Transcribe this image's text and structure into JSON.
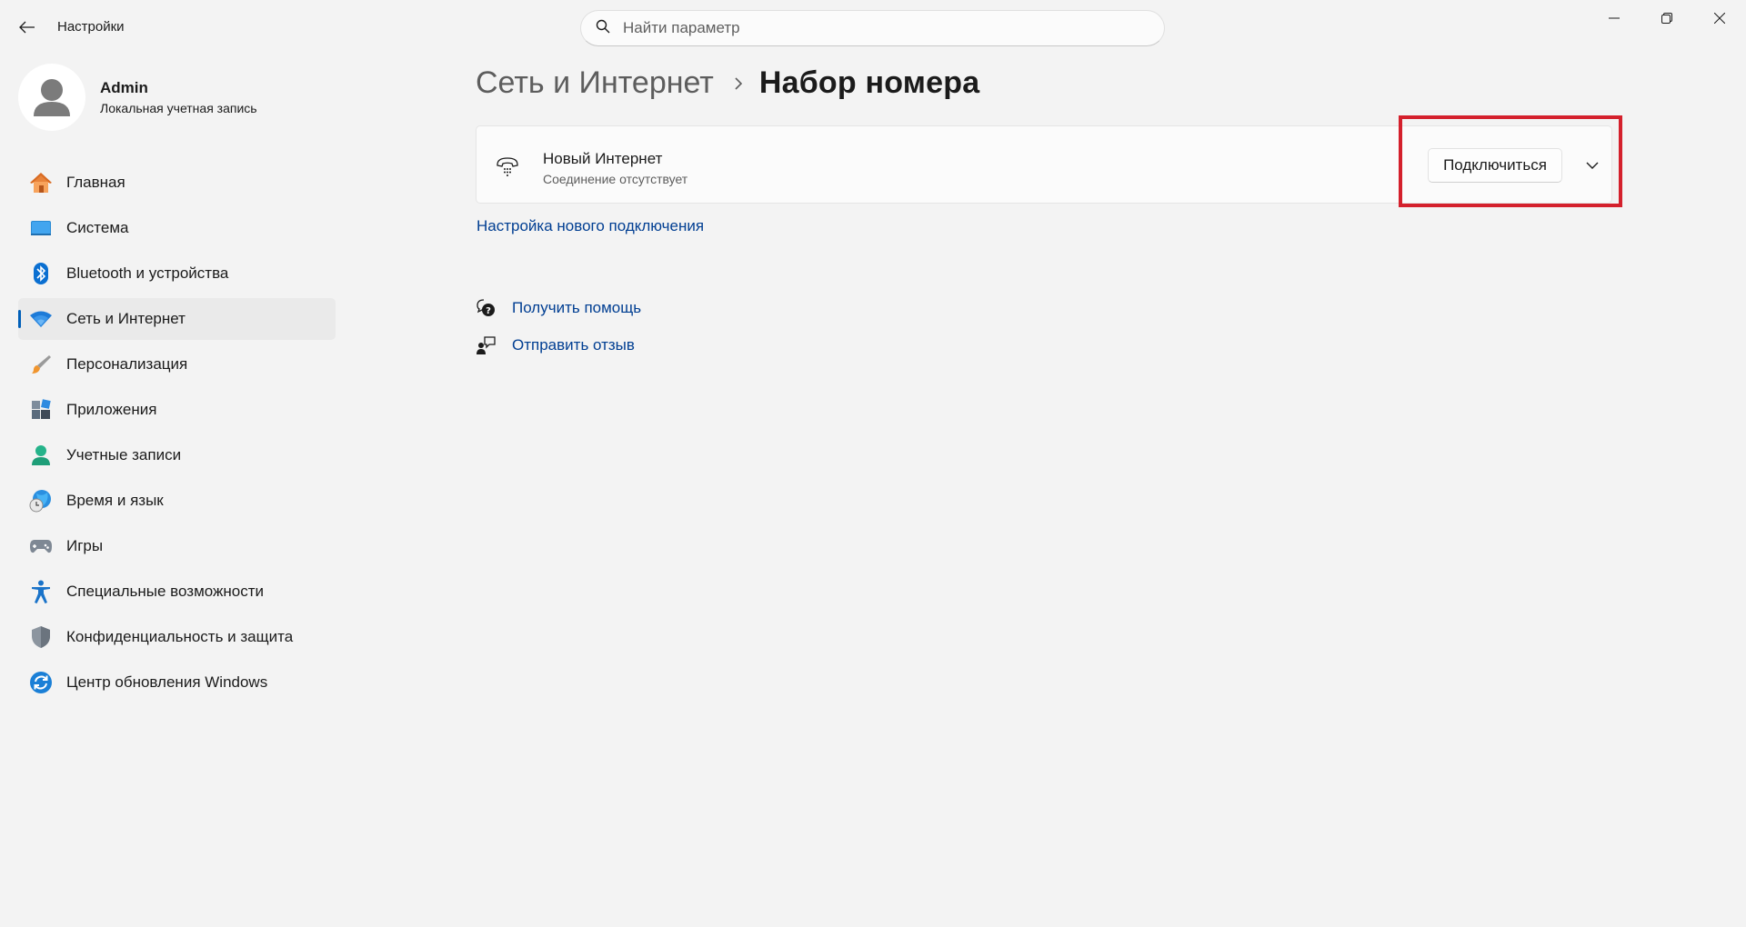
{
  "window": {
    "app_title": "Настройки"
  },
  "search": {
    "placeholder": "Найти параметр"
  },
  "profile": {
    "name": "Admin",
    "account_type": "Локальная учетная запись"
  },
  "sidebar": {
    "items": [
      {
        "label": "Главная",
        "icon": "home-icon",
        "active": false
      },
      {
        "label": "Система",
        "icon": "system-display-icon",
        "active": false
      },
      {
        "label": "Bluetooth и устройства",
        "icon": "bluetooth-icon",
        "active": false
      },
      {
        "label": "Сеть и Интернет",
        "icon": "wifi-network-icon",
        "active": true
      },
      {
        "label": "Персонализация",
        "icon": "paintbrush-icon",
        "active": false
      },
      {
        "label": "Приложения",
        "icon": "apps-icon",
        "active": false
      },
      {
        "label": "Учетные записи",
        "icon": "account-person-icon",
        "active": false
      },
      {
        "label": "Время и язык",
        "icon": "globe-clock-icon",
        "active": false
      },
      {
        "label": "Игры",
        "icon": "gamepad-icon",
        "active": false
      },
      {
        "label": "Специальные возможности",
        "icon": "accessibility-icon",
        "active": false
      },
      {
        "label": "Конфиденциальность и защита",
        "icon": "shield-icon",
        "active": false
      },
      {
        "label": "Центр обновления Windows",
        "icon": "windows-update-icon",
        "active": false
      }
    ]
  },
  "breadcrumb": {
    "parent": "Сеть и Интернет",
    "current": "Набор номера"
  },
  "connection": {
    "name": "Новый Интернет",
    "status": "Соединение отсутствует",
    "connect_label": "Подключиться",
    "icon": "dialup-phone-icon"
  },
  "links": {
    "new_connection": "Настройка нового подключения",
    "get_help": "Получить помощь",
    "send_feedback": "Отправить отзыв"
  },
  "colors": {
    "accent": "#005fb8",
    "link": "#003e92",
    "highlight": "#d4202c",
    "background": "#f3f3f3"
  }
}
